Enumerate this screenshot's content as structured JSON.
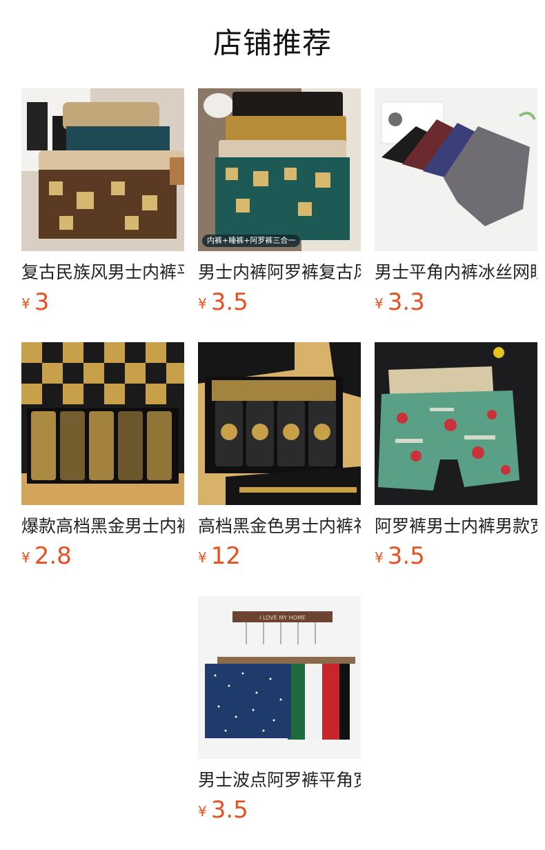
{
  "section": {
    "title": "店铺推荐"
  },
  "colors": {
    "price": "#e8501f",
    "title_text": "#222222"
  },
  "products": [
    {
      "title": "复古民族风男士内裤平角裤",
      "currency": "¥",
      "price": "3",
      "image": "brown-tribal-boxers-photo"
    },
    {
      "title": "男士内裤阿罗裤复古风睡裤",
      "currency": "¥",
      "price": "3.5",
      "image": "teal-tribal-shorts-photo",
      "badge": "内裤+睡裤+阿罗裤三合一"
    },
    {
      "title": "男士平角内裤冰丝网眼透气",
      "currency": "¥",
      "price": "3.3",
      "image": "grey-mesh-boxers-photo"
    },
    {
      "title": "爆款高档黑金男士内裤礼盒",
      "currency": "¥",
      "price": "2.8",
      "image": "black-gold-boxers-box-photo"
    },
    {
      "title": "高档黑金色男士内裤礼盒装",
      "currency": "¥",
      "price": "12",
      "image": "black-gold-gift-box-photo"
    },
    {
      "title": "阿罗裤男士内裤男款宽松",
      "currency": "¥",
      "price": "3.5",
      "image": "green-print-shorts-photo"
    },
    {
      "title": "男士波点阿罗裤平角宽松",
      "currency": "¥",
      "price": "3.5",
      "image": "polka-dot-shorts-hanging-photo",
      "sign": "I LOVE MY HOME"
    }
  ]
}
